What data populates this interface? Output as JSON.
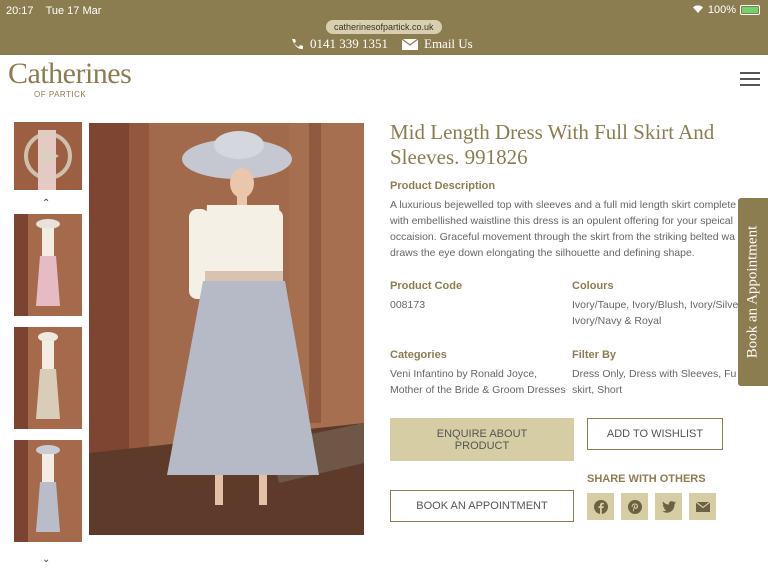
{
  "status_bar": {
    "time": "20:17",
    "date": "Tue 17 Mar",
    "battery": "100%"
  },
  "url": "catherinesofpartick.co.uk",
  "contact": {
    "phone": "0141 339 1351",
    "email_label": "Email Us"
  },
  "logo": {
    "name": "Catherines",
    "sub": "OF PARTICK"
  },
  "product": {
    "title": "Mid Length Dress With Full Skirt And Sleeves. 991826",
    "description_label": "Product Description",
    "description_lines": [
      "A luxurious bejewelled top with sleeves and a full mid length skirt complete",
      "with embellished waistline this dress is an opulent offering for your speical",
      "occaision. Graceful movement through the skirt from the striking belted wa",
      "draws the eye down elongating the silhouette and defining shape."
    ],
    "code_label": "Product Code",
    "code": "008173",
    "colours_label": "Colours",
    "colours_lines": [
      "Ivory/Taupe, Ivory/Blush, Ivory/Silve",
      "Ivory/Navy & Royal"
    ],
    "categories_label": "Categories",
    "categories_lines": [
      "Veni Infantino by Ronald Joyce,",
      "Mother of the Bride & Groom Dresses"
    ],
    "filter_label": "Filter By",
    "filter_lines": [
      "Dress Only, Dress with Sleeves, Fu",
      "skirt, Short"
    ]
  },
  "buttons": {
    "enquire": "ENQUIRE ABOUT PRODUCT",
    "wishlist": "ADD TO WISHLIST",
    "appointment": "BOOK AN APPOINTMENT"
  },
  "share": {
    "label": "SHARE WITH OTHERS",
    "icons": [
      "facebook-icon",
      "pinterest-icon",
      "twitter-icon",
      "email-icon"
    ]
  },
  "side_tab": "Book an Appointment",
  "colors": {
    "brand": "#8c7d51",
    "button_fill": "#d6cda5"
  }
}
